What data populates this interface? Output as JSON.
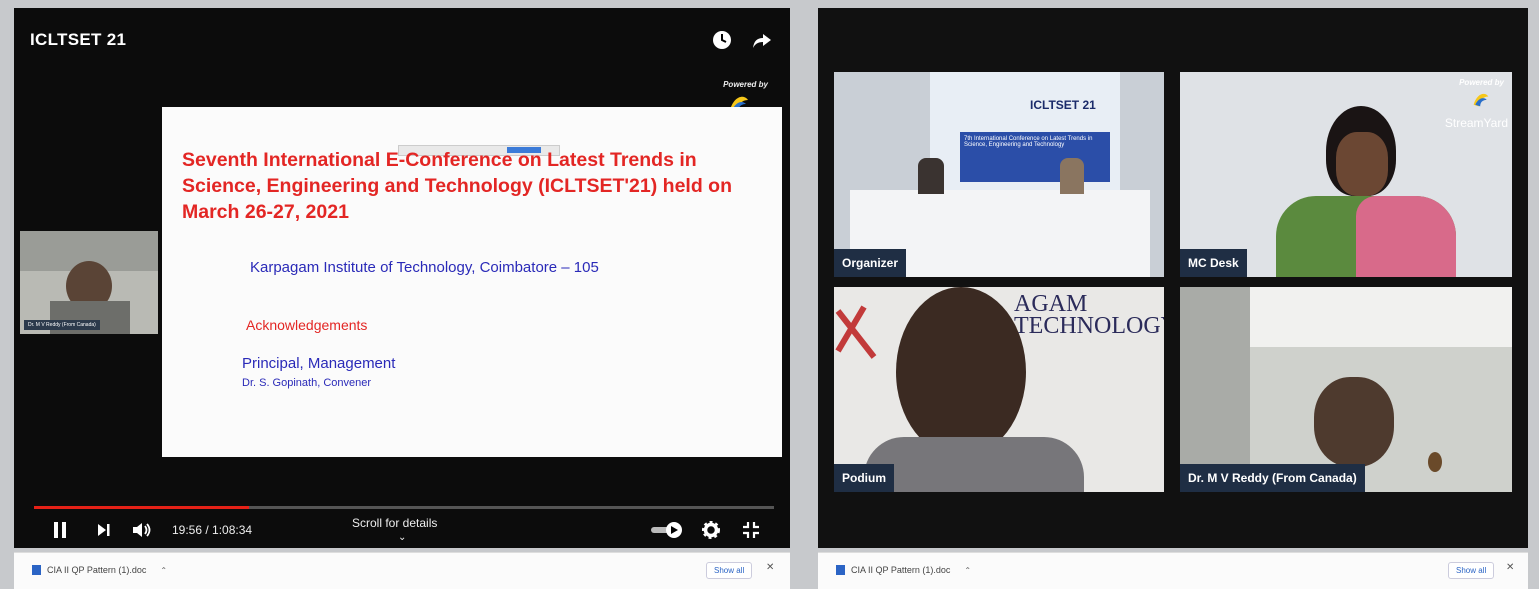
{
  "left_player": {
    "title": "ICLTSET 21",
    "powered_by": "Powered by",
    "slide": {
      "title": "Seventh International E-Conference on Latest Trends in Science, Engineering and Technology (ICLTSET'21) held on March 26-27, 2021",
      "institute": "Karpagam Institute of Technology, Coimbatore – 105",
      "acknowledgements": "Acknowledgements",
      "principal": "Principal, Management",
      "convener": "Dr. S. Gopinath, Convener"
    },
    "thumbnail_label": "Dr. M V Reddy (From Canada)",
    "time": "19:56 / 1:08:34",
    "progress_fraction": 0.29,
    "scroll_hint": "Scroll for details"
  },
  "right_grid": {
    "powered_by": "Powered by",
    "streamyard": "StreamYard",
    "tiles": [
      {
        "label": "Organizer"
      },
      {
        "label": "MC Desk"
      },
      {
        "label": "Podium"
      },
      {
        "label": "Dr. M V Reddy (From Canada)"
      }
    ],
    "banner_title": "ICLTSET 21",
    "banner_sub": "7th International Conference on Latest Trends in Science, Engineering and Technology",
    "wall_text": "AGAM\nTECHNOLOGY"
  },
  "download_bar_left": {
    "file": "CIA II QP Pattern (1).doc",
    "show_all": "Show all"
  },
  "download_bar_right": {
    "file": "CIA II QP Pattern (1).doc",
    "show_all": "Show all"
  },
  "colors": {
    "accent_red": "#e32624",
    "slide_blue": "#2a2ab8",
    "label_bg": "#1f2e44",
    "progress": "#e62117"
  }
}
